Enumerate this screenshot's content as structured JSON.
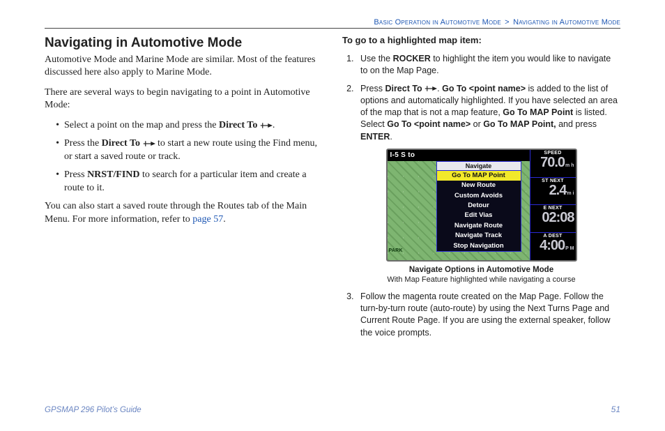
{
  "header": {
    "crumb_left": "Basic Operation in Automotive Mode",
    "sep": ">",
    "crumb_right": "Navigating in Automotive Mode"
  },
  "left": {
    "heading": "Navigating in Automotive Mode",
    "p1": "Automotive Mode and Marine Mode are similar. Most of the features discussed here also apply to Marine Mode.",
    "p2": "There are several ways to begin navigating to a point in Automotive Mode:",
    "b1_a": "Select a point on the map and press the ",
    "b1_b": "Direct To ",
    "b1_c": ".",
    "b2_a": "Press the ",
    "b2_b": "Direct To ",
    "b2_c": " to start a new route using the Find menu, or start a saved route or track.",
    "b3_a": "Press ",
    "b3_b": "NRST/FIND",
    "b3_c": " to search for a particular item and create a route to it.",
    "p3_a": "You can also start a saved route through the Routes tab of the Main Menu. For more information, refer to ",
    "p3_link": "page 57",
    "p3_b": "."
  },
  "right": {
    "sub": "To go to a highlighted map item:",
    "s1_a": "Use the ",
    "s1_b": "ROCKER",
    "s1_c": " to highlight the item you would like to navigate to on the Map Page.",
    "s2_a": "Press ",
    "s2_b": "Direct To ",
    "s2_c": ". ",
    "s2_d": "Go To <point name>",
    "s2_e": " is added to the list of options and automatically highlighted. If you have selected an area of the map that is not a map feature, ",
    "s2_f": "Go To MAP Point",
    "s2_g": " is listed. Select ",
    "s2_h": "Go To <point name>",
    "s2_i": " or ",
    "s2_j": "Go To MAP Point,",
    "s2_k": " and press ",
    "s2_l": "ENTER",
    "s2_m": ".",
    "cap1": "Navigate Options in Automotive Mode",
    "cap2": "With Map Feature highlighted while navigating a course",
    "s3": "Follow the magenta route created on the Map Page. Follow the turn-by-turn route (auto-route) by using the Next Turns Page and Current Route Page. If you are using the external speaker, follow the voice prompts."
  },
  "device": {
    "top_status": "I-5 S to",
    "menu_title": "Navigate",
    "menu_items": [
      "Go To MAP Point",
      "New Route",
      "Custom Avoids",
      "Detour",
      "Edit Vias",
      "Navigate Route",
      "Navigate Track",
      "Stop Navigation"
    ],
    "panels": {
      "speed": {
        "label": "SPEED",
        "value": "70.0",
        "unit": "m h"
      },
      "next": {
        "label": "ST NEXT",
        "value": "2.4",
        "unit": "m i"
      },
      "eta": {
        "label": "E NEXT",
        "value": "02:08",
        "unit": ""
      },
      "dest": {
        "label": "A DEST",
        "value": "4:00",
        "unit": "P M"
      }
    },
    "map_label": "PARK"
  },
  "footer": {
    "guide": "GPSMAP 296 Pilot’s Guide",
    "page": "51"
  }
}
